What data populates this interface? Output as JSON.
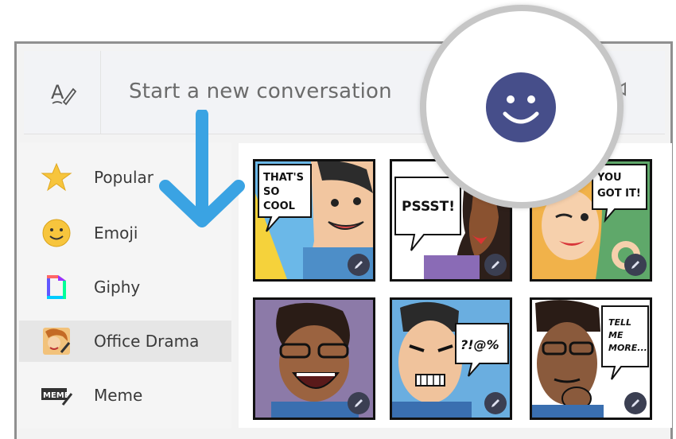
{
  "compose": {
    "placeholder": "Start a new conversation",
    "format_icon": "format-text-icon",
    "video_icon": "video-icon"
  },
  "emoji_button": {
    "icon": "smiley-face-icon",
    "color": "#464e8a"
  },
  "annotation": {
    "icon": "down-arrow-icon",
    "color": "#3aa3e3"
  },
  "sidebar": {
    "items": [
      {
        "label": "Popular",
        "icon": "star-icon",
        "active": false
      },
      {
        "label": "Emoji",
        "icon": "emoji-smile-icon",
        "active": false
      },
      {
        "label": "Giphy",
        "icon": "giphy-icon",
        "active": false
      },
      {
        "label": "Office Drama",
        "icon": "office-drama-icon",
        "active": true
      },
      {
        "label": "Meme",
        "icon": "meme-icon",
        "active": false
      }
    ]
  },
  "stickers": [
    {
      "caption": [
        "THAT'S",
        "SO",
        "COOL"
      ]
    },
    {
      "caption": [
        "PSSST!"
      ]
    },
    {
      "caption": [
        "YOU",
        "GOT IT!"
      ]
    },
    {
      "caption": []
    },
    {
      "caption": [
        "?!@%"
      ]
    },
    {
      "caption": [
        "TELL",
        "ME",
        "MORE..."
      ]
    }
  ]
}
